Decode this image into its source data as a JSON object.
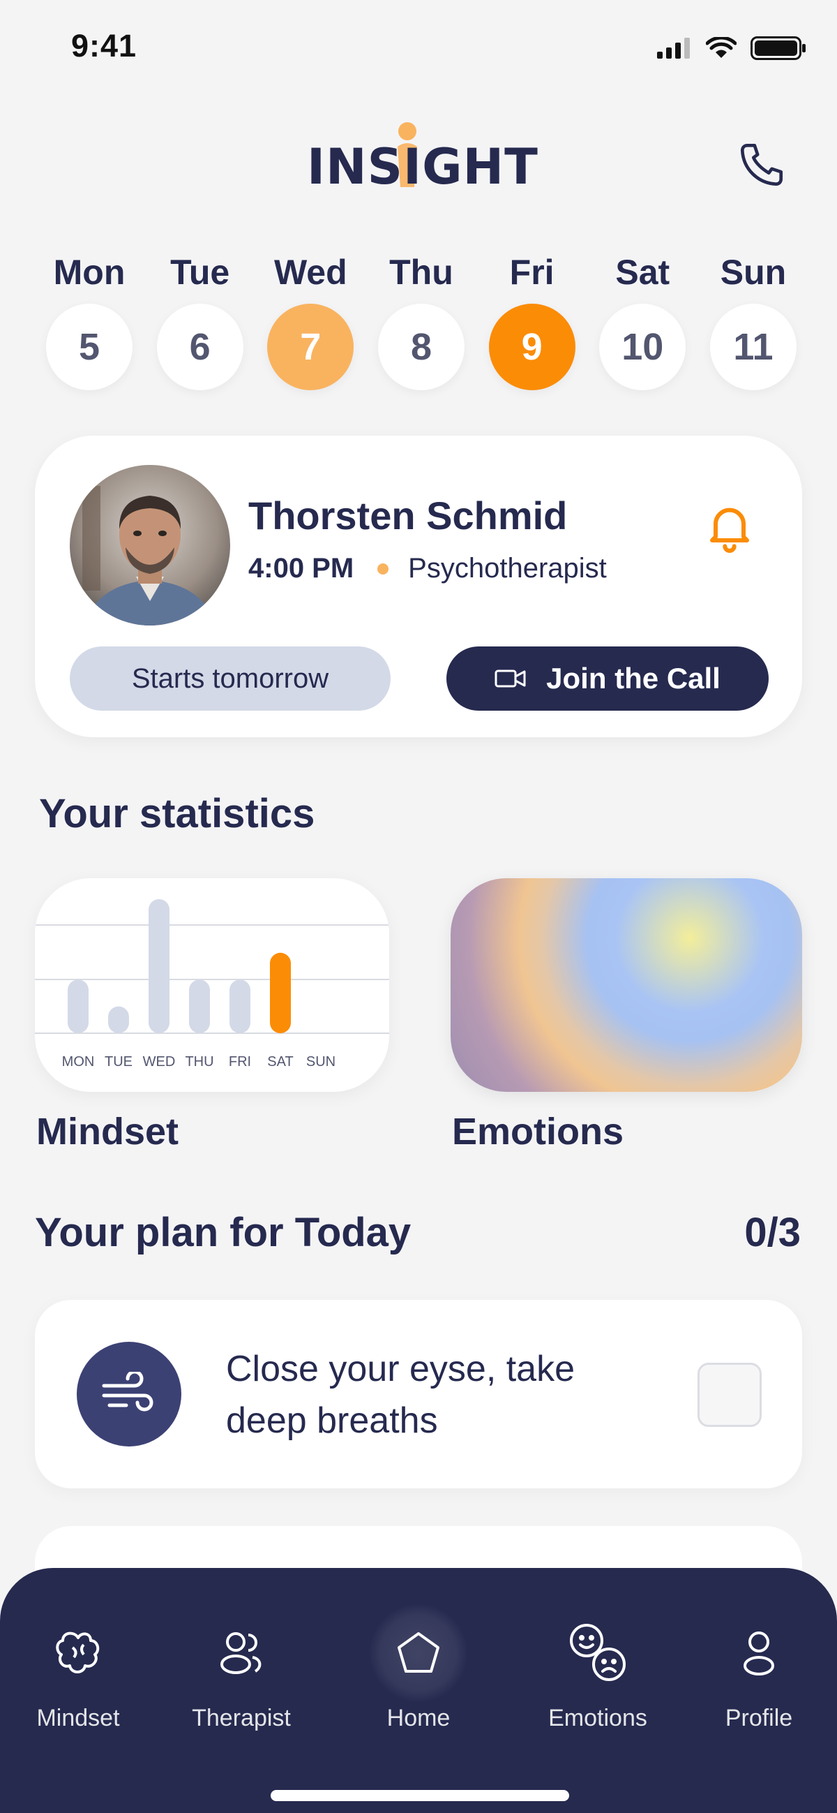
{
  "status_bar": {
    "time": "9:41"
  },
  "header": {
    "logo_text": "INSIGHT",
    "phone_icon": "phone-icon",
    "brand_accent": "#f9b35f"
  },
  "week": [
    {
      "name": "Mon",
      "num": "5",
      "state": "normal"
    },
    {
      "name": "Tue",
      "num": "6",
      "state": "normal"
    },
    {
      "name": "Wed",
      "num": "7",
      "state": "light"
    },
    {
      "name": "Thu",
      "num": "8",
      "state": "normal"
    },
    {
      "name": "Fri",
      "num": "9",
      "state": "active"
    },
    {
      "name": "Sat",
      "num": "10",
      "state": "normal"
    },
    {
      "name": "Sun",
      "num": "11",
      "state": "normal"
    }
  ],
  "session": {
    "name": "Thorsten Schmid",
    "time": "4:00 PM",
    "role": "Psychotherapist",
    "starts_label": "Starts tomorrow",
    "join_label": "Join the Call",
    "bell_icon": "bell-icon",
    "video_icon": "video-camera-icon"
  },
  "statistics": {
    "title": "Your statistics",
    "mindset_label": "Mindset",
    "emotions_label": "Emotions"
  },
  "chart_data": {
    "type": "bar",
    "categories": [
      "MON",
      "TUE",
      "WED",
      "THU",
      "FRI",
      "SAT",
      "SUN"
    ],
    "values": [
      2,
      1,
      5,
      2,
      2,
      3,
      0
    ],
    "highlight": "SAT",
    "ylim": [
      0,
      5
    ],
    "grid": true,
    "colors": {
      "bar": "#d3d9e7",
      "highlight": "#fb8c06"
    }
  },
  "plan": {
    "title": "Your plan for Today",
    "count": "0/3",
    "tasks": [
      {
        "text": "Close your eyse, take deep breaths",
        "icon": "wind-icon",
        "done": false
      }
    ]
  },
  "nav": {
    "items": [
      {
        "label": "Mindset",
        "icon": "brain-icon"
      },
      {
        "label": "Therapist",
        "icon": "users-icon"
      },
      {
        "label": "Home",
        "icon": "home-pentagon-icon",
        "active": true
      },
      {
        "label": "Emotions",
        "icon": "emotions-faces-icon"
      },
      {
        "label": "Profile",
        "icon": "user-icon"
      }
    ]
  },
  "colors": {
    "navy": "#262a4f",
    "orange": "#fb8c06",
    "light_orange": "#f9b35f",
    "background": "#f4f4f5"
  }
}
